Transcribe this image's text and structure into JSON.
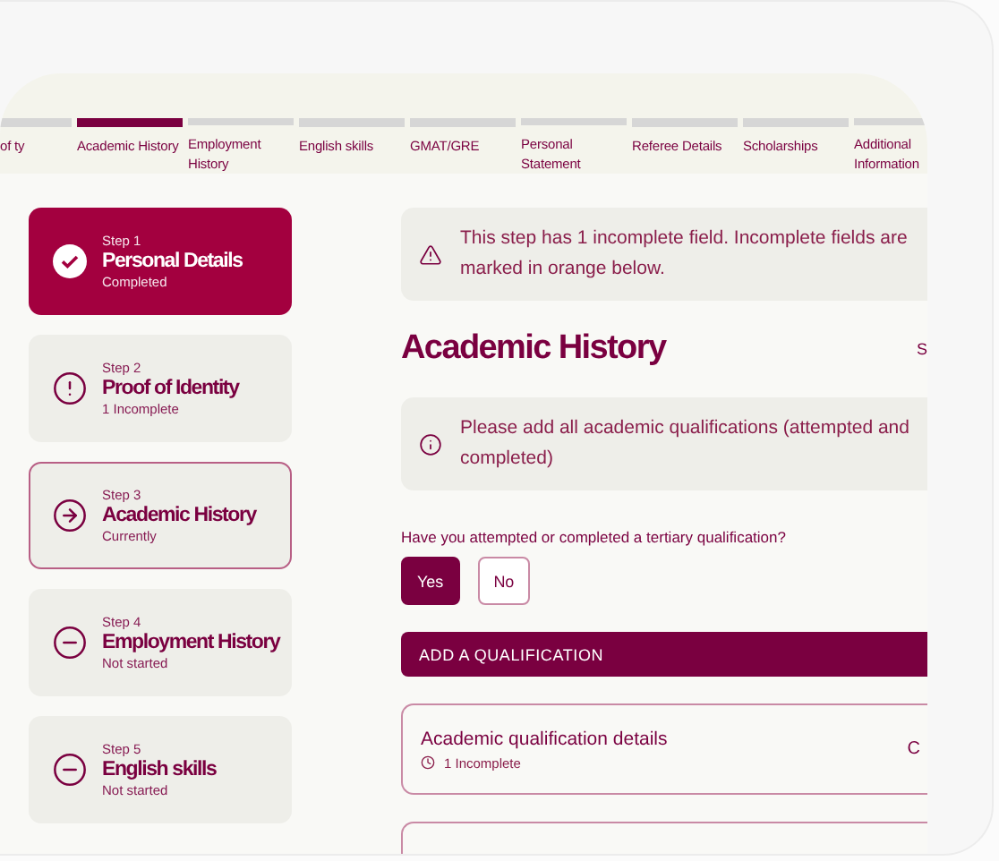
{
  "progress_tabs": [
    {
      "label": "of ty",
      "selected": false
    },
    {
      "label": "Academic History",
      "selected": true
    },
    {
      "label": "Employment History",
      "selected": false
    },
    {
      "label": "English skills",
      "selected": false
    },
    {
      "label": "GMAT/GRE",
      "selected": false
    },
    {
      "label": "Personal Statement",
      "selected": false
    },
    {
      "label": "Referee Details",
      "selected": false
    },
    {
      "label": "Scholarships",
      "selected": false
    },
    {
      "label": "Additional Information",
      "selected": false
    }
  ],
  "steps": [
    {
      "step": "Step 1",
      "title": "Personal Details",
      "status": "Completed",
      "kind": "completed"
    },
    {
      "step": "Step 2",
      "title": "Proof of Identity",
      "status": "1 Incomplete",
      "kind": "incomplete"
    },
    {
      "step": "Step 3",
      "title": "Academic History",
      "status": "Currently",
      "kind": "current"
    },
    {
      "step": "Step 4",
      "title": "Employment History",
      "status": "Not started",
      "kind": "not_started"
    },
    {
      "step": "Step 5",
      "title": "English skills",
      "status": "Not started",
      "kind": "not_started"
    }
  ],
  "alert": {
    "text": "This step has 1 incomplete field. Incomplete fields are marked in orange below."
  },
  "heading": "Academic History",
  "heading_action": "S",
  "info": {
    "text": "Please add all academic qualifications (attempted and completed)"
  },
  "question": {
    "label": "Have you attempted or completed a tertiary qualification?",
    "options": [
      {
        "label": "Yes",
        "selected": true
      },
      {
        "label": "No",
        "selected": false
      }
    ]
  },
  "add_button": "ADD A QUALIFICATION",
  "qualifications": [
    {
      "kind": "entry",
      "title": "Academic qualification details",
      "status": "1 Incomplete",
      "action": "C"
    },
    {
      "kind": "blank"
    }
  ]
}
